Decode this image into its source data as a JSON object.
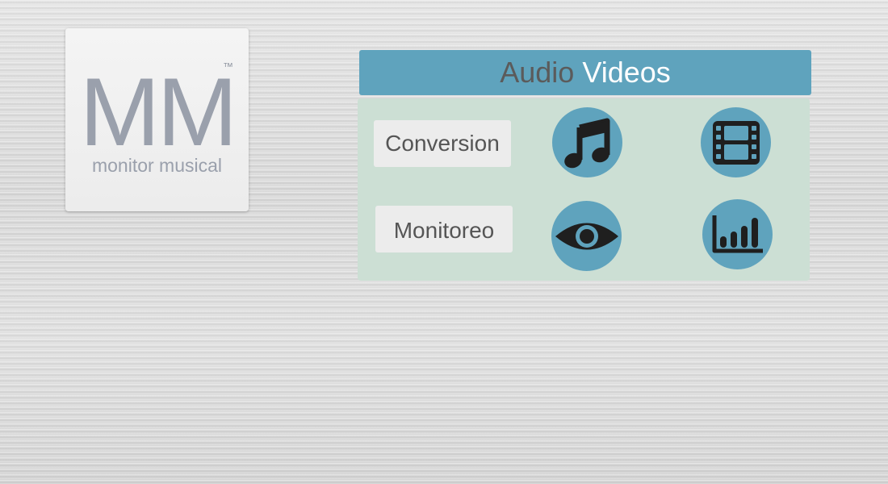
{
  "logo": {
    "initials": "MM",
    "trademark": "™",
    "subtitle": "monitor musical"
  },
  "header": {
    "title_part1": "Audio",
    "title_part2": "Videos"
  },
  "buttons": {
    "conversion": "Conversion",
    "monitoreo": "Monitoreo"
  },
  "icons": [
    {
      "name": "music-note-icon"
    },
    {
      "name": "film-strip-icon"
    },
    {
      "name": "eye-icon"
    },
    {
      "name": "bar-chart-icon"
    }
  ],
  "colors": {
    "accent": "#5fa3bd",
    "panel": "#ccdfd4",
    "logo_text": "#9aa0ac",
    "icon_dark": "#1f1f1f"
  }
}
